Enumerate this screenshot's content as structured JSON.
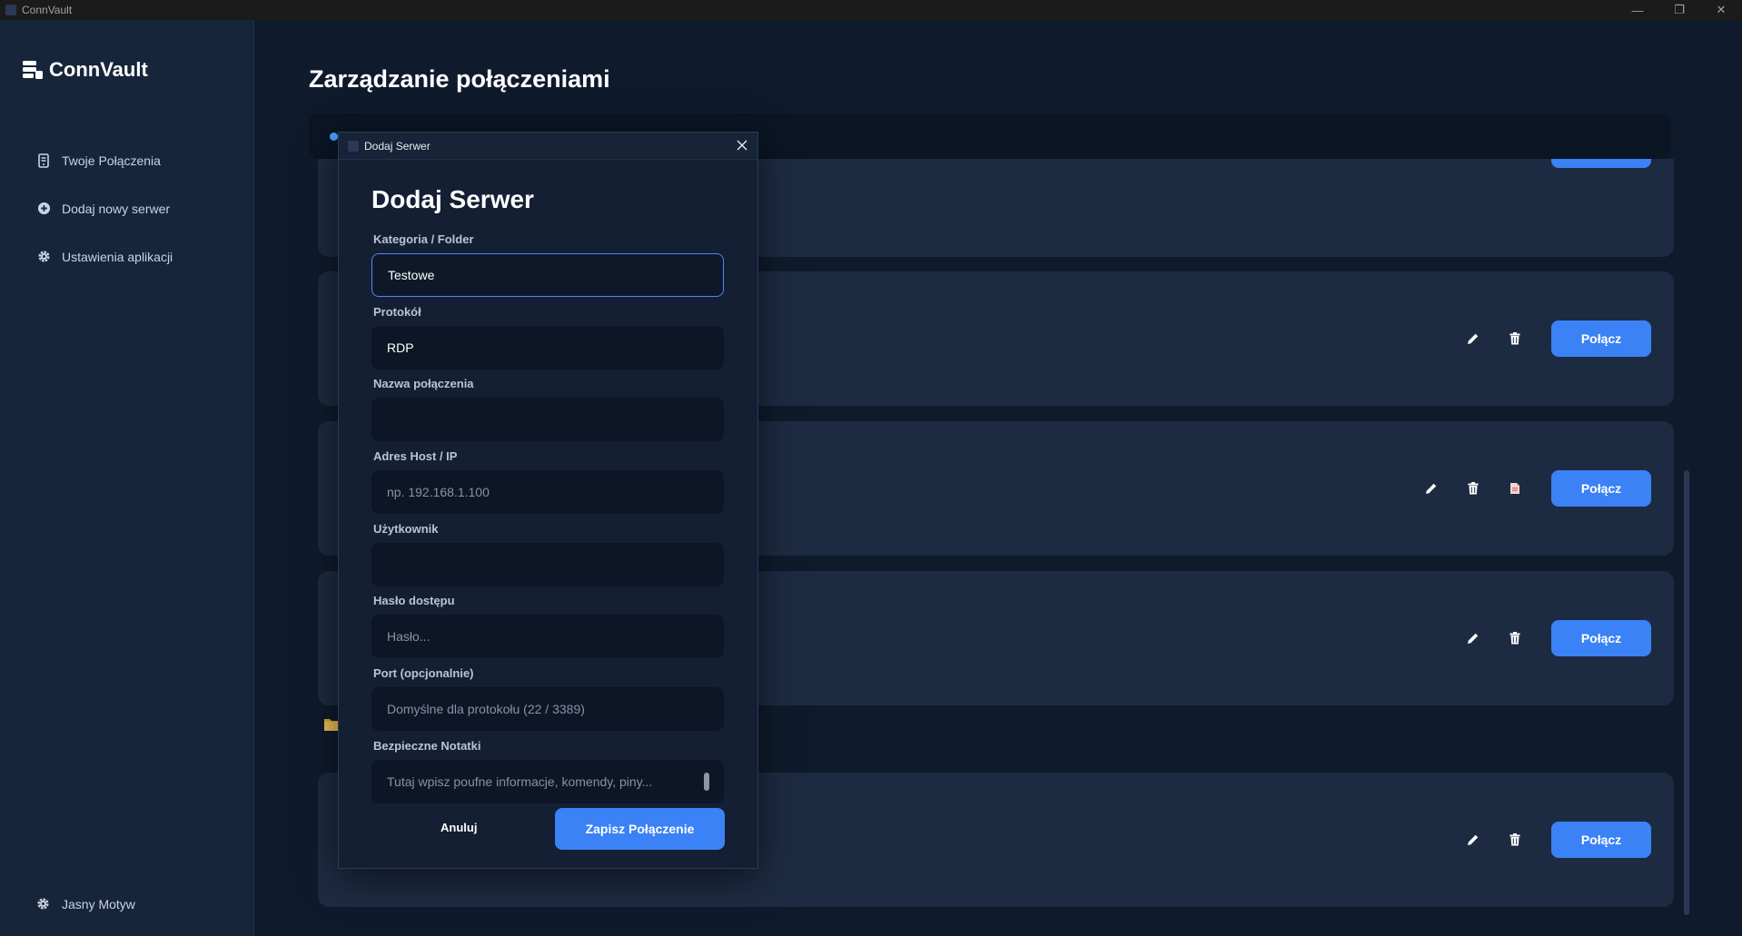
{
  "window": {
    "title": "ConnVault"
  },
  "sidebar": {
    "logo": "ConnVault",
    "items": [
      {
        "label": "Twoje Połączenia",
        "icon": "server-icon"
      },
      {
        "label": "Dodaj nowy serwer",
        "icon": "plus-circle-icon"
      },
      {
        "label": "Ustawienia aplikacji",
        "icon": "gear-icon"
      }
    ],
    "theme_toggle": "Jasny Motyw"
  },
  "main": {
    "title": "Zarządzanie połączeniami",
    "connect_label": "Połącz"
  },
  "dialog": {
    "window_title": "Dodaj Serwer",
    "heading": "Dodaj Serwer",
    "fields": {
      "category": {
        "label": "Kategoria / Folder",
        "value": "Testowe"
      },
      "protocol": {
        "label": "Protokół",
        "value": "RDP"
      },
      "name": {
        "label": "Nazwa połączenia",
        "value": ""
      },
      "host": {
        "label": "Adres Host / IP",
        "placeholder": "np. 192.168.1.100"
      },
      "user": {
        "label": "Użytkownik",
        "value": ""
      },
      "password": {
        "label": "Hasło dostępu",
        "placeholder": "Hasło..."
      },
      "port": {
        "label": "Port (opcjonalnie)",
        "placeholder": "Domyślne dla protokołu (22 / 3389)"
      },
      "notes": {
        "label": "Bezpieczne Notatki",
        "placeholder": "Tutaj wpisz poufne informacje, komendy, piny..."
      }
    },
    "cancel_label": "Anuluj",
    "save_label": "Zapisz Połączenie"
  },
  "colors": {
    "accent": "#3b82f6",
    "background": "#0f1b2d",
    "sidebar": "#17253b",
    "card": "#1d2b42"
  }
}
